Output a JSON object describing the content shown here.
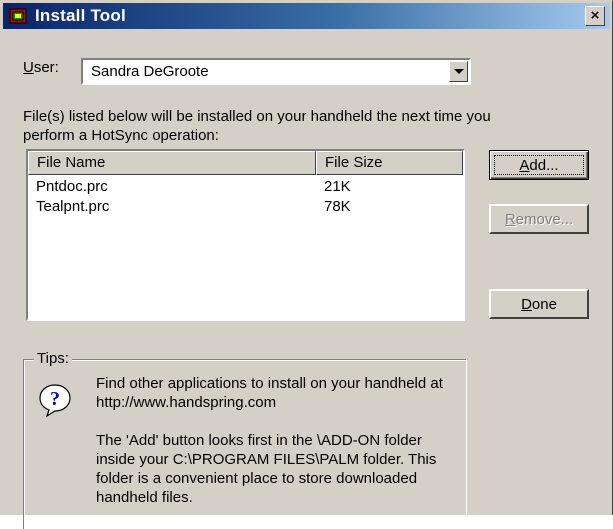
{
  "window": {
    "title": "Install Tool",
    "close_label": "×"
  },
  "user": {
    "label_prefix": "",
    "label_u": "U",
    "label_rest": "ser:",
    "selected": "Sandra DeGroote"
  },
  "info_text": "File(s) listed below will be installed on your handheld the next time you perform a HotSync operation:",
  "file_list": {
    "columns": [
      "File Name",
      "File Size"
    ],
    "rows": [
      {
        "name": "Pntdoc.prc",
        "size": "21K"
      },
      {
        "name": "Tealpnt.prc",
        "size": "78K"
      }
    ]
  },
  "buttons": {
    "add_u": "A",
    "add_rest": "dd...",
    "remove_u": "R",
    "remove_rest": "emove...",
    "done_u": "D",
    "done_rest": "one"
  },
  "tips": {
    "label": "Tips:",
    "paragraph1": "Find other applications to install on your handheld at http://www.handspring.com",
    "paragraph2": "The 'Add' button looks first in the \\ADD-ON folder inside your C:\\PROGRAM FILES\\PALM folder. This folder is a convenient place to store downloaded handheld files."
  },
  "icons": {
    "app": "palm-install-icon",
    "tips": "question-mark-icon"
  },
  "colors": {
    "title_start": "#0a246a",
    "title_end": "#a6caf0",
    "face": "#d4d0c8",
    "icon_blue": "#0000c0"
  }
}
